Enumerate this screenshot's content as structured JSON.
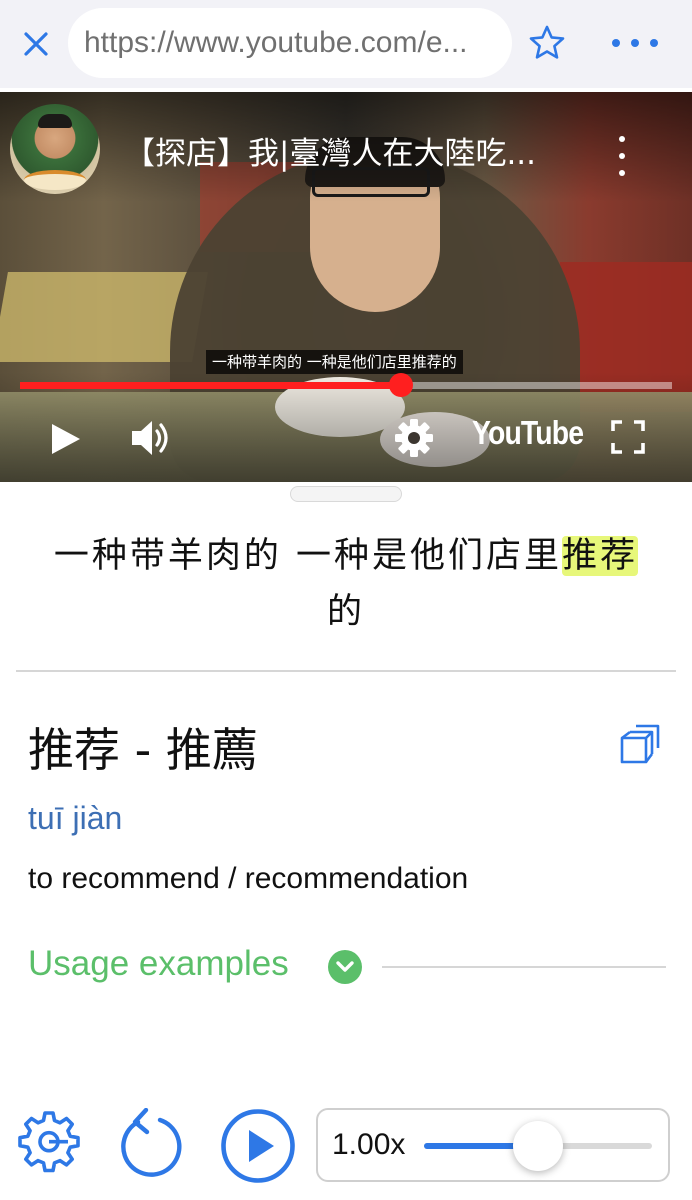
{
  "browser": {
    "url": "https://www.youtube.com/e...",
    "close_icon": "close-icon",
    "bookmark_icon": "star-icon",
    "more_icon": "more-dots-icon"
  },
  "video": {
    "title": "【探店】我|臺灣人在大陸吃...",
    "caption": "一种带羊肉的 一种是他们店里推荐的",
    "progress": 0.585,
    "logo_text": "YouTube",
    "icons": [
      "play-icon",
      "volume-icon",
      "settings-icon",
      "fullscreen-icon",
      "kebab-menu-icon"
    ]
  },
  "subtitle": {
    "before": "一种带羊肉的 一种是他们店里",
    "highlight": "推荐",
    "after": "的"
  },
  "entry": {
    "headword": "推荐 - 推薦",
    "pinyin": "tuī jiàn",
    "definition": "to recommend / recommendation",
    "usage_label": "Usage examples"
  },
  "controls": {
    "speed_label": "1.00x",
    "speed_level": 0.5,
    "icons": [
      "gear-icon",
      "replay-icon",
      "play-circle-icon"
    ]
  },
  "colors": {
    "accent_blue": "#2e78e6",
    "progress_red": "#ff1f1f",
    "highlight_yellow": "#e7f77a",
    "usage_green": "#5bbf6a",
    "pinyin_blue": "#3d6fb4"
  }
}
